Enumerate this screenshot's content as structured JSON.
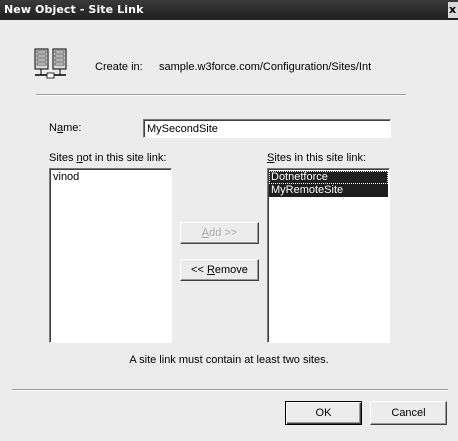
{
  "window": {
    "title": "New Object - Site Link",
    "close_glyph": "x"
  },
  "create_in": {
    "label": "Create in:",
    "path": "sample.w3force.com/Configuration/Sites/Int",
    "icon": "site-link-icon"
  },
  "name_field": {
    "label_pre": "N",
    "label_accel": "a",
    "label_post": "me:",
    "value": "MySecondSite"
  },
  "sites_not_in": {
    "label_pre": "Sites ",
    "label_accel": "n",
    "label_post": "ot in this site link:",
    "items": [
      "vinod"
    ]
  },
  "sites_in": {
    "label_pre": "",
    "label_accel": "S",
    "label_post": "ites in this site link:",
    "items": [
      "Dotnetforce",
      "MyRemoteSite"
    ]
  },
  "buttons": {
    "add_pre": "",
    "add_accel": "A",
    "add_post": "dd >>",
    "remove_pre": "<< ",
    "remove_accel": "R",
    "remove_post": "emove",
    "ok": "OK",
    "cancel": "Cancel"
  },
  "notice": "A site link must contain at least two sites.",
  "colors": {
    "dialog_bg": "#ececec",
    "titlebar": "#2a2a2a",
    "selection": "#1e1e1e"
  }
}
